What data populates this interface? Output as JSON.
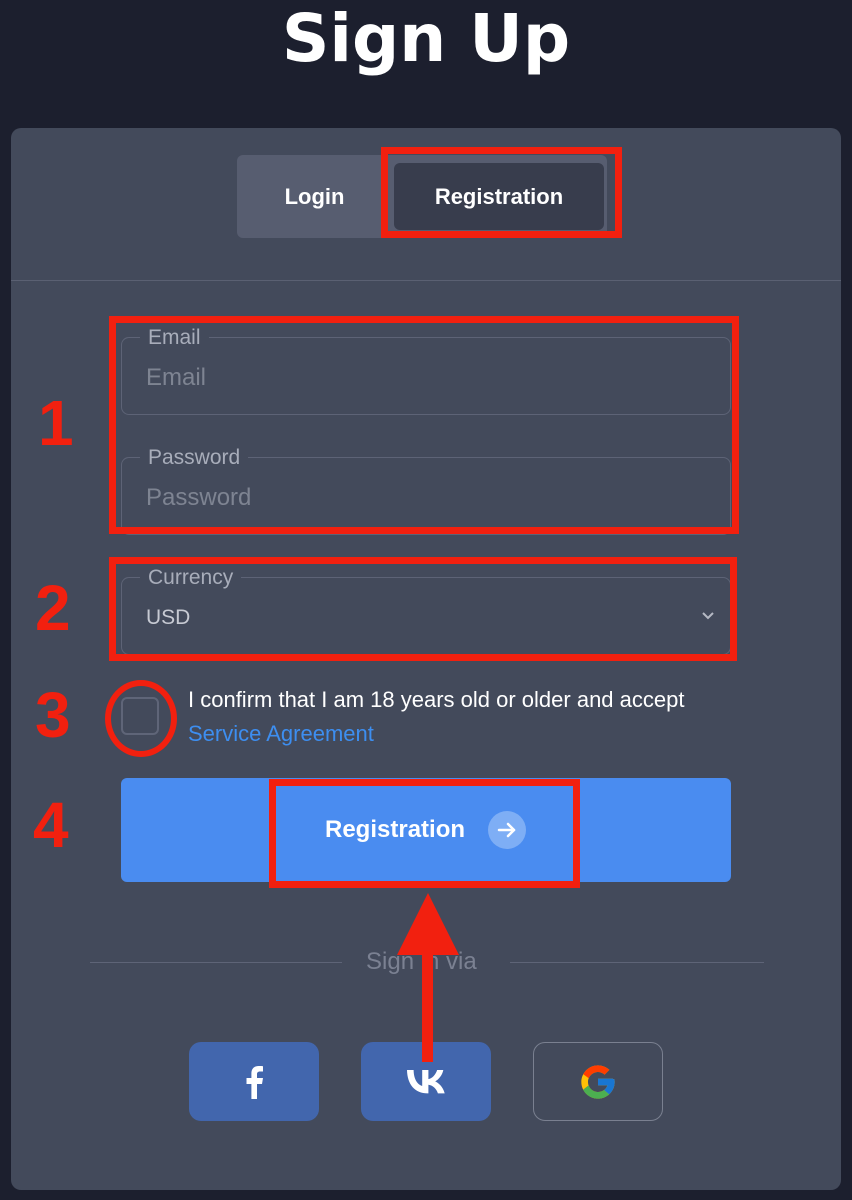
{
  "title": "Sign Up",
  "tabs": {
    "login": "Login",
    "registration": "Registration"
  },
  "form": {
    "email": {
      "label": "Email",
      "placeholder": "Email"
    },
    "password": {
      "label": "Password",
      "placeholder": "Password"
    },
    "currency": {
      "label": "Currency",
      "value": "USD"
    }
  },
  "agreement": {
    "text": "I confirm that I am 18 years old or older and accept",
    "link": "Service Agreement"
  },
  "submit": {
    "label": "Registration",
    "icon": "arrow-right-icon"
  },
  "social": {
    "divider": "Sign in via",
    "providers": [
      "facebook-icon",
      "vk-icon",
      "google-icon"
    ]
  },
  "annotations": {
    "step1": "1",
    "step2": "2",
    "step3": "3",
    "step4": "4"
  },
  "colors": {
    "background": "#1c1f2e",
    "panel": "#434a5b",
    "accent": "#4a8cf0",
    "link": "#3d8ef0",
    "annotation": "#f2200f"
  }
}
